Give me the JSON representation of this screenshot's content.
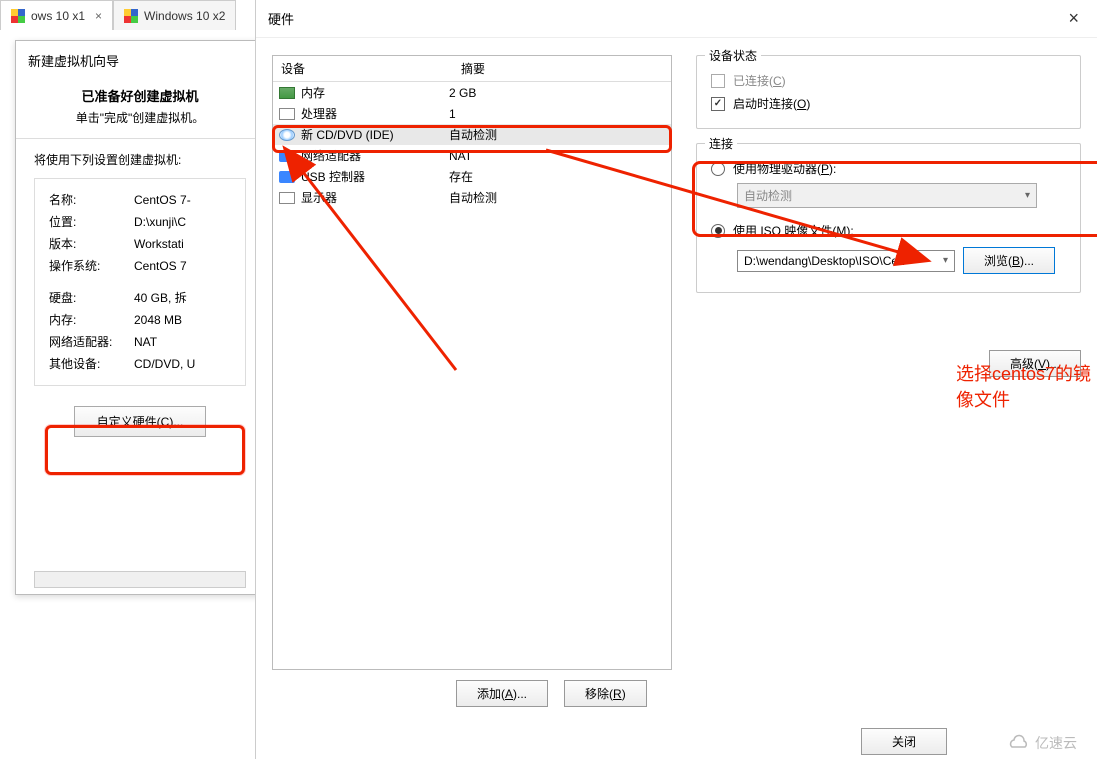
{
  "tabs": [
    {
      "icon": "windows",
      "label": "ows 10 x1",
      "active": true
    },
    {
      "icon": "windows",
      "label": "Windows 10 x2",
      "active": false
    }
  ],
  "wizard": {
    "title": "新建虚拟机向导",
    "heading": "已准备好创建虚拟机",
    "sub": "单击\"完成\"创建虚拟机。",
    "desc": "将使用下列设置创建虚拟机:",
    "rows": [
      {
        "k": "名称:",
        "v": "CentOS 7-"
      },
      {
        "k": "位置:",
        "v": "D:\\xunji\\C"
      },
      {
        "k": "版本:",
        "v": "Workstati"
      },
      {
        "k": "操作系统:",
        "v": "CentOS 7"
      }
    ],
    "rows2": [
      {
        "k": "硬盘:",
        "v": "40 GB, 拆"
      },
      {
        "k": "内存:",
        "v": "2048 MB"
      },
      {
        "k": "网络适配器:",
        "v": "NAT"
      },
      {
        "k": "其他设备:",
        "v": "CD/DVD, U"
      }
    ],
    "customize_btn": "自定义硬件(C)...",
    "customize_u": "C"
  },
  "hw": {
    "title": "硬件",
    "dev_header": {
      "c1": "设备",
      "c2": "摘要"
    },
    "devices": [
      {
        "icon": "mem",
        "name": "内存",
        "summary": "2 GB"
      },
      {
        "icon": "cpu",
        "name": "处理器",
        "summary": "1"
      },
      {
        "icon": "cd",
        "name": "新 CD/DVD (IDE)",
        "summary": "自动检测",
        "selected": true
      },
      {
        "icon": "net",
        "name": "网络适配器",
        "summary": "NAT"
      },
      {
        "icon": "usb",
        "name": "USB 控制器",
        "summary": "存在"
      },
      {
        "icon": "disp",
        "name": "显示器",
        "summary": "自动检测"
      }
    ],
    "add_btn": "添加(A)...",
    "remove_btn": "移除(R)",
    "status": {
      "legend": "设备状态",
      "connected": "已连接(C)",
      "connected_u": "C",
      "connect_on": "启动时连接(O)",
      "connect_on_u": "O"
    },
    "conn": {
      "legend": "连接",
      "physical": "使用物理驱动器(P):",
      "physical_u": "P",
      "auto_detect": "自动检测",
      "use_iso": "使用 ISO 映像文件(M):",
      "use_iso_u": "M",
      "iso_path": "D:\\wendang\\Desktop\\ISO\\Cen",
      "browse": "浏览(B)...",
      "browse_u": "B"
    },
    "advanced": "高级(V)...",
    "advanced_u": "V",
    "close": "关闭"
  },
  "annotation": "选择centos7的镜像文件",
  "watermark": "亿速云"
}
